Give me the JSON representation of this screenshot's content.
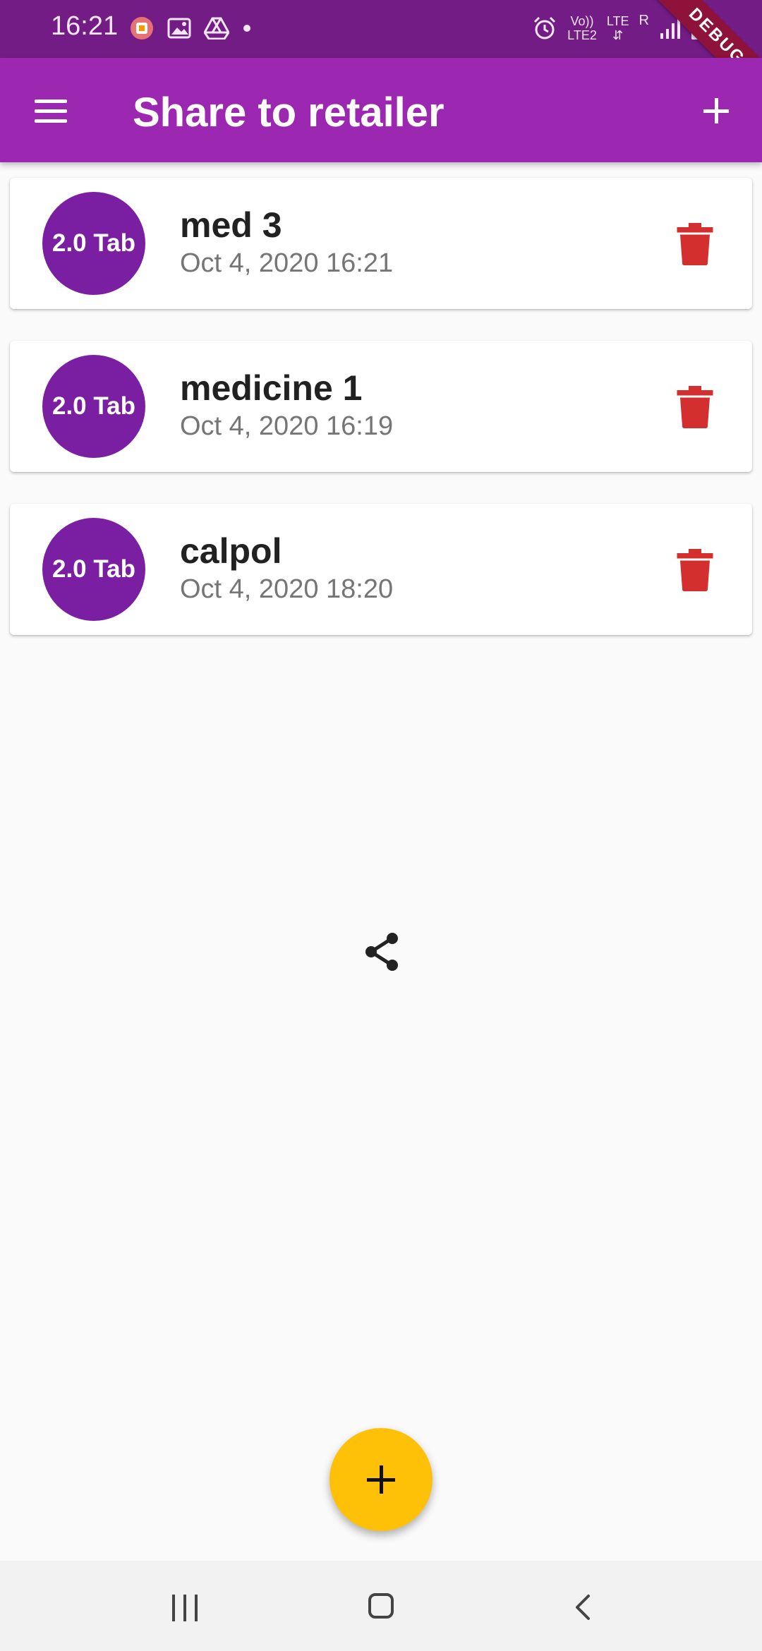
{
  "status_bar": {
    "time": "16:21",
    "left_icons": [
      "notification-app-icon",
      "gallery-icon",
      "drive-icon",
      "dot-icon"
    ],
    "network_top": "Vo))",
    "network_bottom": "LTE2",
    "lte_label": "LTE",
    "roaming_label": "R",
    "right_icons": [
      "alarm-icon",
      "signal-icon",
      "battery-icon"
    ],
    "debug_label": "DEBUG"
  },
  "app_bar": {
    "title": "Share to retailer",
    "menu_icon": "menu-icon",
    "add_icon": "add-icon"
  },
  "items": [
    {
      "badge": "2.0 Tab",
      "name": "med 3",
      "date": "Oct 4, 2020 16:21"
    },
    {
      "badge": "2.0 Tab",
      "name": "medicine 1",
      "date": "Oct 4, 2020 16:19"
    },
    {
      "badge": "2.0 Tab",
      "name": "calpol",
      "date": "Oct 4, 2020 18:20"
    }
  ],
  "icons": {
    "delete": "trash-icon",
    "share": "share-icon",
    "fab": "add-icon"
  },
  "colors": {
    "status_bar": "#741c86",
    "app_bar": "#9c27b0",
    "avatar": "#7b1fa2",
    "delete": "#d32f2f",
    "fab": "#ffc107"
  }
}
